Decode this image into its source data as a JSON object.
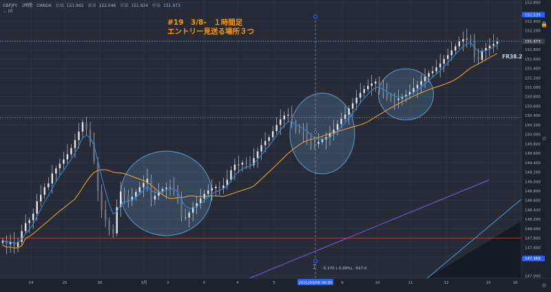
{
  "header": {
    "symbol": "GBPJPY",
    "timeframe": "1時間",
    "broker": "OANDA",
    "ohlc": [
      {
        "label": "始値",
        "value": "151.992"
      },
      {
        "label": "高値",
        "value": "152.046"
      },
      {
        "label": "安値",
        "value": "151.924"
      },
      {
        "label": "終値",
        "value": "151.973"
      }
    ],
    "indicator_toggle": "10"
  },
  "annotation": {
    "line1": "#19　3/8-　１時間足",
    "line2": "エントリー見送る場所３つ"
  },
  "fib_label": "FR38.2",
  "measure_text": "-5.170 (-3.39%), -517.0",
  "crosshair_time": "2021/03/06 06:00",
  "price_labels": {
    "current": "151.973",
    "top": "152.539",
    "bottom": "147.369"
  },
  "colors": {
    "background": "#272b38",
    "candle": "#e0e3eb",
    "ma_fast": "#2f8bd6",
    "ma_slow": "#f0a030",
    "channel": "#4aa3df",
    "channel_lower": "#7b5ce6",
    "horizontal_red": "#c0504d",
    "circle_fill": "#6ea8d8",
    "note": "#ff9800",
    "price_badge": "#2962ff"
  },
  "chart_data": {
    "type": "candlestick",
    "title": "",
    "y_ticks": [
      "152.800",
      "152.400",
      "152.200",
      "152.000",
      "151.800",
      "151.600",
      "151.400",
      "151.200",
      "151.000",
      "150.800",
      "150.600",
      "150.400",
      "150.200",
      "150.000",
      "149.800",
      "149.600",
      "149.400",
      "149.200",
      "149.000",
      "148.800",
      "148.600",
      "148.400",
      "148.200",
      "148.000",
      "147.800",
      "147.600",
      "147.400",
      "147.000"
    ],
    "x_ticks": [
      "24",
      "25",
      "26",
      "3月",
      "2",
      "3",
      "4",
      "5",
      "2021/03/06 06:00",
      "9",
      "10",
      "11",
      "12",
      "15",
      "16"
    ],
    "ylim": [
      146.95,
      152.85
    ],
    "horizontal_lines": [
      {
        "name": "current-price",
        "price": 151.973,
        "style": "dotted"
      },
      {
        "name": "level",
        "price": 150.35,
        "style": "dotted"
      },
      {
        "name": "support",
        "price": 147.8,
        "style": "solid-red"
      }
    ],
    "highlight_zones": [
      {
        "name": "zone-1",
        "time_index": 43,
        "price": 148.75
      },
      {
        "name": "zone-2",
        "time_index": 84,
        "price": 150.02
      },
      {
        "name": "zone-3",
        "time_index": 106,
        "price": 150.85
      }
    ],
    "closes": [
      147.75,
      147.67,
      147.72,
      147.62,
      147.72,
      147.95,
      148.12,
      148.18,
      148.32,
      148.58,
      148.72,
      148.88,
      148.96,
      149.17,
      149.28,
      149.38,
      149.47,
      149.58,
      149.71,
      149.88,
      150.06,
      150.26,
      150.1,
      149.83,
      149.43,
      148.8,
      148.41,
      148.18,
      147.98,
      147.9,
      148.46,
      148.79,
      148.7,
      148.6,
      148.68,
      148.78,
      148.88,
      148.97,
      149.06,
      148.62,
      148.7,
      148.78,
      148.84,
      148.87,
      148.88,
      148.84,
      148.65,
      148.24,
      148.24,
      148.34,
      148.46,
      148.54,
      148.64,
      148.74,
      148.81,
      148.86,
      148.89,
      148.86,
      148.92,
      149.04,
      149.24,
      149.36,
      149.36,
      149.4,
      149.38,
      149.35,
      149.5,
      149.64,
      149.77,
      149.86,
      149.94,
      150.07,
      150.2,
      150.32,
      150.4,
      150.42,
      150.25,
      150.11,
      150.08,
      150.04,
      149.95,
      149.82,
      149.8,
      149.84,
      149.89,
      149.94,
      150.02,
      150.1,
      150.22,
      150.33,
      150.42,
      150.55,
      150.66,
      150.78,
      150.88,
      150.96,
      151.03,
      151.08,
      151.12,
      151.0,
      150.88,
      150.8,
      150.75,
      150.73,
      150.76,
      150.8,
      150.84,
      150.9,
      150.98,
      151.05,
      151.13,
      151.22,
      151.3,
      151.34,
      151.42,
      151.5,
      151.6,
      151.68,
      151.78,
      151.87,
      151.97,
      152.02,
      152.03,
      152.0,
      151.64,
      151.58,
      151.77,
      151.83,
      151.88,
      151.92,
      151.97
    ]
  }
}
